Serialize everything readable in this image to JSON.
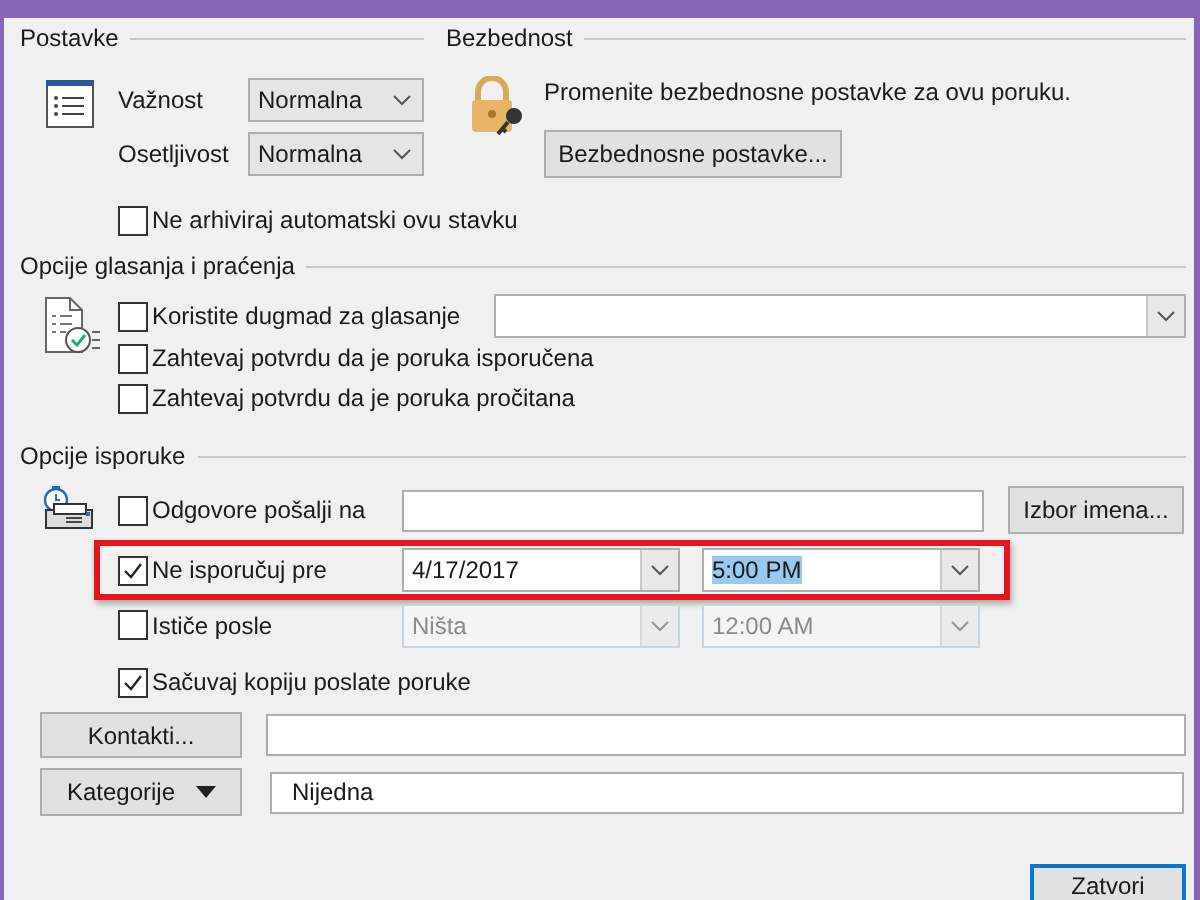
{
  "settings": {
    "title": "Postavke",
    "fields": [
      {
        "label": "Važnost",
        "value": "Normalna"
      },
      {
        "label": "Osetljivost",
        "value": "Normalna"
      }
    ],
    "no_autoarchive": {
      "label": "Ne arhiviraj automatski ovu stavku",
      "checked": false
    }
  },
  "security": {
    "title": "Bezbednost",
    "text": "Promenite bezbednosne postavke za ovu poruku.",
    "button": "Bezbednosne postavke..."
  },
  "voting": {
    "title": "Opcije glasanja i praćenja",
    "options": [
      {
        "label": "Koristite dugmad za glasanje",
        "checked": false,
        "kind": "combo"
      },
      {
        "label": "Zahtevaj potvrdu da je poruka isporučena",
        "checked": false,
        "kind": "plain"
      },
      {
        "label": "Zahtevaj potvrdu da je poruka pročitana",
        "checked": false,
        "kind": "plain"
      }
    ]
  },
  "delivery": {
    "title": "Opcije isporuke",
    "reply_to": {
      "label": "Odgovore pošalji na",
      "checked": false,
      "button": "Izbor imena..."
    },
    "schedule": [
      {
        "label": "Ne isporučuj pre",
        "checked": true,
        "date": "4/17/2017",
        "time": "5:00 PM",
        "time_selected": true,
        "disabled": false,
        "highlighted": true
      },
      {
        "label": "Ističe posle",
        "checked": false,
        "date": "Ništa",
        "time": "12:00 AM",
        "time_selected": false,
        "disabled": true,
        "highlighted": false
      }
    ],
    "save_copy": {
      "label": "Sačuvaj kopiju poslate poruke",
      "checked": true
    }
  },
  "contacts": {
    "button": "Kontakti..."
  },
  "categories": {
    "button": "Kategorije",
    "value": "Nijedna"
  },
  "buttons": [
    {
      "label": "Zatvori",
      "default": true
    }
  ]
}
